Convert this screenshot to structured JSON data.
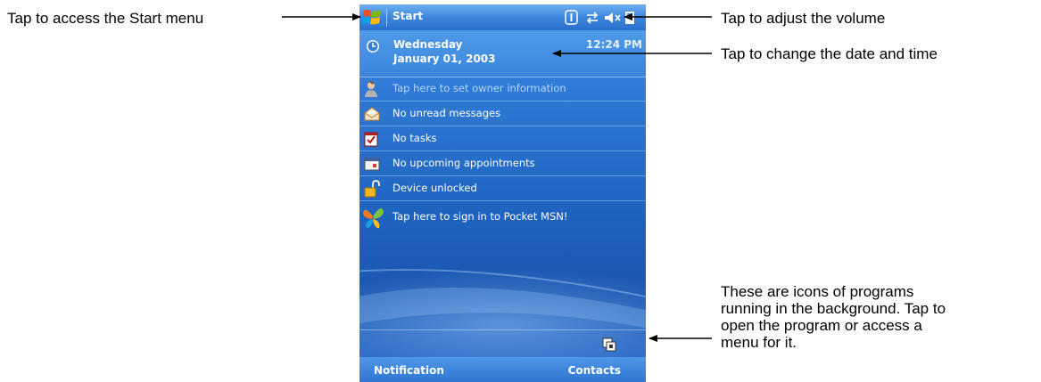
{
  "callouts": {
    "start_menu": "Tap to access the Start menu",
    "volume": "Tap to adjust the volume",
    "date_time": "Tap to change the date and time",
    "background_programs": [
      "These are icons of programs",
      "running in the background. Tap to",
      "open the program or access a",
      "menu for it."
    ]
  },
  "device": {
    "title": "Start",
    "tray_icons": [
      "connectivity-icon",
      "sync-icon",
      "volume-mute-icon",
      "battery-icon"
    ],
    "date_bar": {
      "day": "Wednesday",
      "date": "January 01, 2003",
      "time": "12:24 PM"
    },
    "today_items": [
      {
        "icon": "owner-icon",
        "label": "Tap here to set owner information"
      },
      {
        "icon": "inbox-icon",
        "label": "No unread messages"
      },
      {
        "icon": "tasks-icon",
        "label": "No tasks"
      },
      {
        "icon": "calendar-icon",
        "label": "No upcoming appointments"
      },
      {
        "icon": "unlock-icon",
        "label": "Device unlocked"
      },
      {
        "icon": "msn-butterfly-icon",
        "label": "Tap here to sign in to Pocket MSN!"
      }
    ],
    "background_program_icon": "background-program-icon",
    "softkeys": {
      "left": "Notification",
      "right": "Contacts"
    }
  },
  "colors": {
    "screen_blue": "#1f63c0",
    "title_bar": "#3d86dc",
    "annotation_text": "#000000"
  }
}
